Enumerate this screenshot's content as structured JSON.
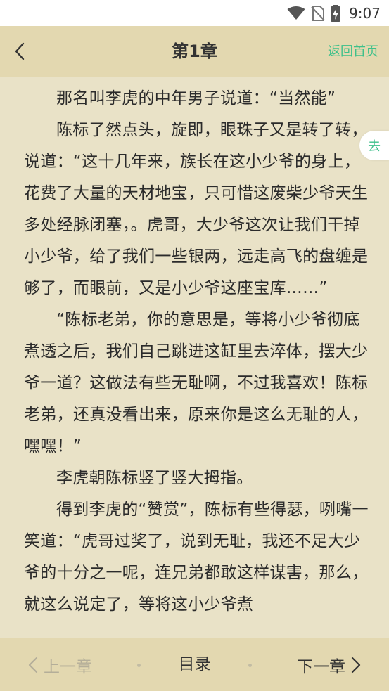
{
  "status_bar": {
    "time": "9:07",
    "icons": [
      "wifi-icon",
      "no-sim-icon",
      "battery-charging-icon"
    ]
  },
  "header": {
    "title": "第1章",
    "home_link": "返回首页",
    "back_icon": "chevron-left-icon"
  },
  "side_button": {
    "label": "去"
  },
  "content": {
    "paragraphs": [
      "那名叫李虎的中年男子说道：“当然能”",
      "陈标了然点头，旋即，眼珠子又是转了转，说道：“这十几年来，族长在这小少爷的身上，花费了大量的天材地宝，只可惜这废柴少爷天生多处经脉闭塞，。虎哥，大少爷这次让我们干掉小少爷，给了我们一些银两，远走高飞的盘缠是够了，而眼前，又是小少爷这座宝库……”",
      "“陈标老弟，你的意思是，等将小少爷彻底煮透之后，我们自己跳进这缸里去淬体，摆大少爷一道？这做法有些无耻啊，不过我喜欢！陈标老弟，还真没看出来，原来你是这么无耻的人，嘿嘿！”",
      "李虎朝陈标竖了竖大拇指。",
      "得到李虎的“赞赏”，陈标有些得瑟，咧嘴一笑道：“虎哥过奖了，说到无耻，我还不足大少爷的十分之一呢，连兄弟都敢这样谋害，那么，就这么说定了，等将这小少爷煮"
    ]
  },
  "bottom_bar": {
    "prev_label": "上一章",
    "toc_label": "目录",
    "next_label": "下一章"
  },
  "colors": {
    "background": "#e9e2c7",
    "bar": "#e3d8b0",
    "accent": "#3cc08a",
    "disabled": "#b4ae99"
  }
}
